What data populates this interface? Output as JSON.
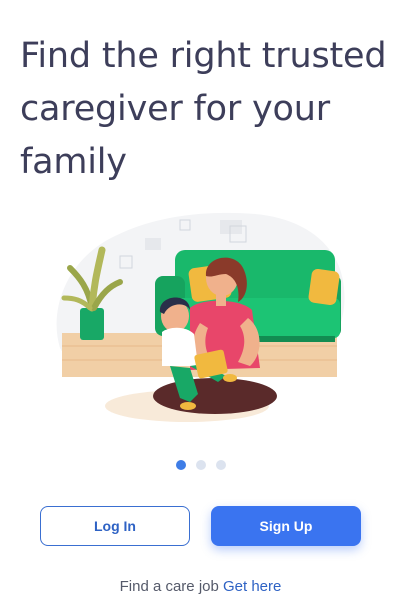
{
  "onboarding": {
    "headline": "Find the right trusted caregiver for your family",
    "carousel": {
      "total_pages": 3,
      "active_page": 1
    },
    "login_label": "Log In",
    "signup_label": "Sign Up",
    "footer_text": "Find a care job",
    "footer_link": "Get here"
  },
  "colors": {
    "primary": "#3a74f0",
    "headline": "#3d3e5a",
    "sofa": "#19b86b",
    "shirt": "#e8466a"
  },
  "icons": {
    "illustration": "mother-and-child-on-sofa-illustration"
  }
}
